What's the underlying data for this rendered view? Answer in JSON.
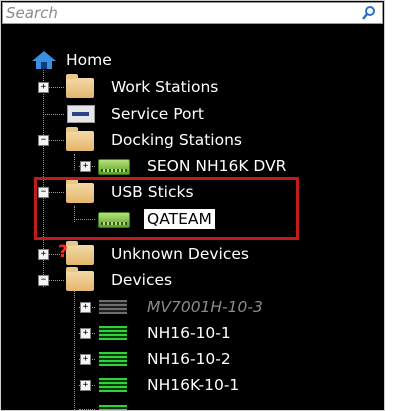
{
  "search": {
    "placeholder": "Search"
  },
  "tree": {
    "root": "Home",
    "work_stations": "Work Stations",
    "service_port": "Service Port",
    "docking_stations": "Docking Stations",
    "seon_dvr": "SEON NH16K DVR",
    "usb_sticks": "USB Sticks",
    "qateam": "QATEAM",
    "unknown_devices": "Unknown Devices",
    "devices": "Devices",
    "device_items": [
      "MV7001H-10-3",
      "NH16-10-1",
      "NH16-10-2",
      "NH16K-10-1"
    ]
  },
  "icons": {
    "search": "magnifier-icon",
    "home": "home-icon",
    "folder": "folder-icon",
    "usb": "usb-drive-icon",
    "rack": "rack-icon"
  },
  "colors": {
    "background": "#000000",
    "text": "#ffffff",
    "disabled_text": "#8b8b8b",
    "highlight_border": "#c21b1b",
    "rack_green": "#2fd23a"
  }
}
